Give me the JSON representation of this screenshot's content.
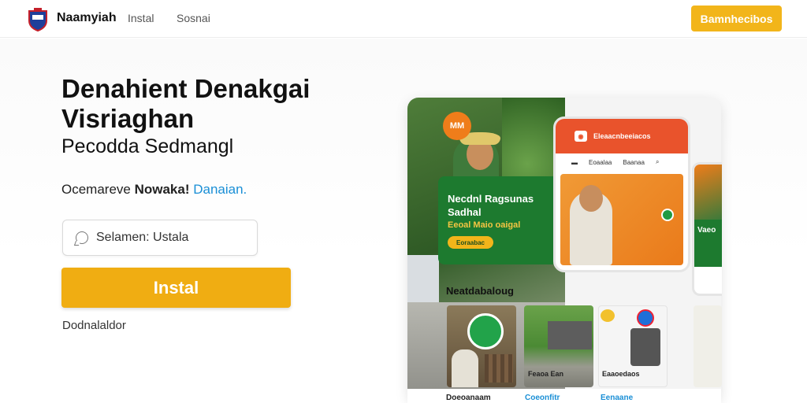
{
  "header": {
    "brand": "Naamyiah",
    "nav": [
      "Instal",
      "Sosnai"
    ],
    "cta": "Bamnhecibos"
  },
  "hero": {
    "title_line1": "Denahient Denakgai",
    "title_line2": "Visriaghan",
    "subtitle": "Pecodda Sedmangl",
    "tagline_plain": "Ocemareve ",
    "tagline_bold": "Nowaka! ",
    "tagline_link": "Danaian.",
    "search_placeholder": "Selamen: Ustala",
    "install_label": "Instal",
    "secondary_link": "Dodnalaldor"
  },
  "mockup": {
    "badge": "MM",
    "promo_title": "Necdnl Ragsunas Sadhal",
    "promo_sub": "Eeoal Maio oaigal",
    "promo_button": "Eoraabac",
    "phone_header": "Eleaacnbeeiacos",
    "phone_tabs": [
      "Eoaalaa",
      "Baanaa"
    ],
    "side_label": "Vaeo",
    "section_title": "Neatdabaloug",
    "thumb_captions": [
      "Feaoa Ean",
      "Eaaoedaos"
    ],
    "bottom_labels": [
      "Doeoanaam",
      "Coeonfitr",
      "Eenaane"
    ]
  },
  "colors": {
    "accent": "#f0ad12",
    "link": "#1a8fd6",
    "green": "#1d7a2f",
    "orange": "#e9532c"
  }
}
